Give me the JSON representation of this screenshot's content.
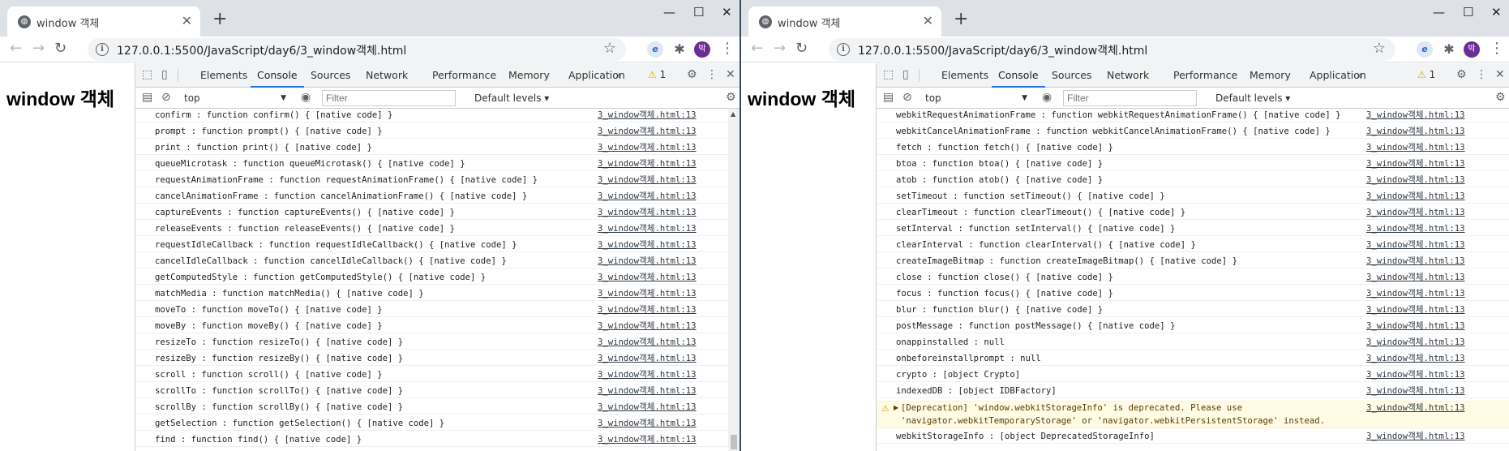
{
  "browser": {
    "tab_title": "window 객체",
    "tab_close": "✕",
    "new_tab": "+",
    "favicon": "globe-icon",
    "url_host": "127.0.0.1",
    "url_rest": ":5500/JavaScript/day6/3_window객체.html",
    "avatar_label": "박",
    "controls": {
      "minimize": "—",
      "maximize": "☐",
      "close": "✕"
    },
    "icons": {
      "back": "←",
      "forward": "→",
      "reload": "↻",
      "info": "i",
      "star": "☆",
      "puzzle": "✱",
      "menu": "⋮",
      "edge_ext": "e"
    }
  },
  "page": {
    "title": "window 객체"
  },
  "devtools": {
    "tabs": [
      "Elements",
      "Console",
      "Sources",
      "Network",
      "Performance",
      "Memory",
      "Application"
    ],
    "active_tab": "Console",
    "more_tabs": "»",
    "warning_count": "1",
    "context": "top",
    "filter_placeholder": "Filter",
    "levels": "Default levels ▾",
    "icons": {
      "inspect": "⬚",
      "device": "▯",
      "sidebar": "▤",
      "clear": "⊘",
      "eye": "◉",
      "gear": "⚙",
      "more": "⋮",
      "close": "✕"
    }
  },
  "left_console": {
    "source": "3_window객체.html:13",
    "rows": [
      "confirm : function confirm() { [native code] }",
      "prompt : function prompt() { [native code] }",
      "print : function print() { [native code] }",
      "queueMicrotask : function queueMicrotask() { [native code] }",
      "requestAnimationFrame : function requestAnimationFrame() { [native code] }",
      "cancelAnimationFrame : function cancelAnimationFrame() { [native code] }",
      "captureEvents : function captureEvents() { [native code] }",
      "releaseEvents : function releaseEvents() { [native code] }",
      "requestIdleCallback : function requestIdleCallback() { [native code] }",
      "cancelIdleCallback : function cancelIdleCallback() { [native code] }",
      "getComputedStyle : function getComputedStyle() { [native code] }",
      "matchMedia : function matchMedia() { [native code] }",
      "moveTo : function moveTo() { [native code] }",
      "moveBy : function moveBy() { [native code] }",
      "resizeTo : function resizeTo() { [native code] }",
      "resizeBy : function resizeBy() { [native code] }",
      "scroll : function scroll() { [native code] }",
      "scrollTo : function scrollTo() { [native code] }",
      "scrollBy : function scrollBy() { [native code] }",
      "getSelection : function getSelection() { [native code] }",
      "find : function find() { [native code] }"
    ]
  },
  "right_console": {
    "source": "3_window객체.html:13",
    "rows_before_warning": [
      "webkitRequestAnimationFrame : function webkitRequestAnimationFrame() { [native code] }",
      "webkitCancelAnimationFrame : function webkitCancelAnimationFrame() { [native code] }",
      "fetch : function fetch() { [native code] }",
      "btoa : function btoa() { [native code] }",
      "atob : function atob() { [native code] }",
      "setTimeout : function setTimeout() { [native code] }",
      "clearTimeout : function clearTimeout() { [native code] }",
      "setInterval : function setInterval() { [native code] }",
      "clearInterval : function clearInterval() { [native code] }",
      "createImageBitmap : function createImageBitmap() { [native code] }",
      "close : function close() { [native code] }",
      "focus : function focus() { [native code] }",
      "blur : function blur() { [native code] }",
      "postMessage : function postMessage() { [native code] }",
      "onappinstalled : null",
      "onbeforeinstallprompt : null",
      "crypto : [object Crypto]",
      "indexedDB : [object IDBFactory]"
    ],
    "warning": {
      "line1": "[Deprecation] 'window.webkitStorageInfo' is deprecated. Please use",
      "line2": "'navigator.webkitTemporaryStorage' or 'navigator.webkitPersistentStorage' instead.",
      "icon": "warning-icon",
      "expander": "▶",
      "glyph": "⚠"
    },
    "rows_after_warning": [
      "webkitStorageInfo : [object DeprecatedStorageInfo]"
    ]
  }
}
